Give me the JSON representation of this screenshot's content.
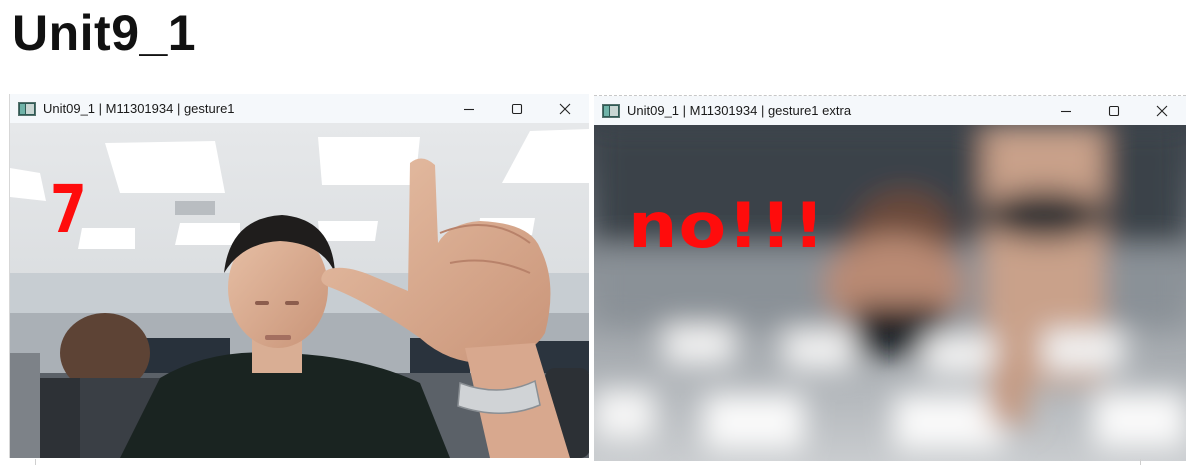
{
  "page": {
    "title": "Unit9_1"
  },
  "windows": [
    {
      "title": "Unit09_1 | M11301934 | gesture1",
      "overlay_text": "7",
      "controls": [
        "minimize",
        "maximize",
        "close"
      ]
    },
    {
      "title": "Unit09_1 | M11301934 | gesture1 extra",
      "overlay_text": "no!!!",
      "controls": [
        "minimize",
        "maximize",
        "close"
      ]
    }
  ],
  "icons": {
    "app": "app-window-icon",
    "minimize": "minimize-icon",
    "maximize": "maximize-icon",
    "close": "close-icon"
  },
  "colors": {
    "overlay_text": "#ff0c0c",
    "titlebar": "#f5f8fb"
  }
}
